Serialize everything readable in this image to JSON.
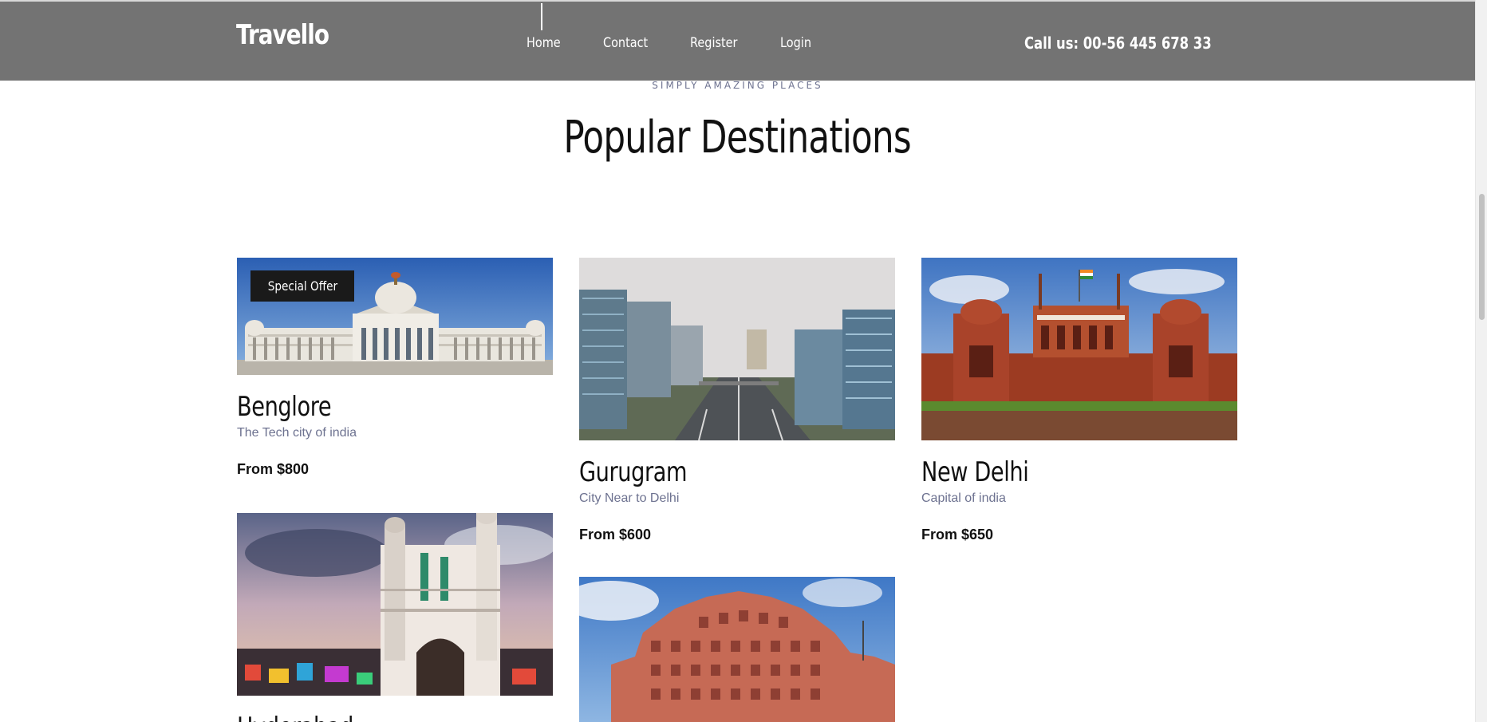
{
  "header": {
    "logo": "Travello",
    "nav": [
      "Home",
      "Contact",
      "Register",
      "Login"
    ],
    "phone": "Call us: 00-56 445 678 33"
  },
  "section": {
    "eyebrow": "SIMPLY AMAZING PLACES",
    "title": "Popular Destinations"
  },
  "cards": [
    {
      "title": "Benglore",
      "subtitle": "The Tech city of india",
      "price": "From $800",
      "badge": "Special Offer",
      "image": "vidhana-soudha-photo"
    },
    {
      "title": "Gurugram",
      "subtitle": "City Near to Delhi",
      "price": "From $600",
      "image": "gurugram-skyline-photo"
    },
    {
      "title": "New Delhi",
      "subtitle": "Capital of india",
      "price": "From $650",
      "image": "red-fort-photo"
    },
    {
      "title": "Hyderabad",
      "image": "charminar-photo"
    },
    {
      "image": "hawa-mahal-photo"
    }
  ],
  "colors": {
    "header_bg": "#737373",
    "accent_text": "#6d7290",
    "heading": "#111111",
    "badge_bg": "#1a1a1a"
  }
}
